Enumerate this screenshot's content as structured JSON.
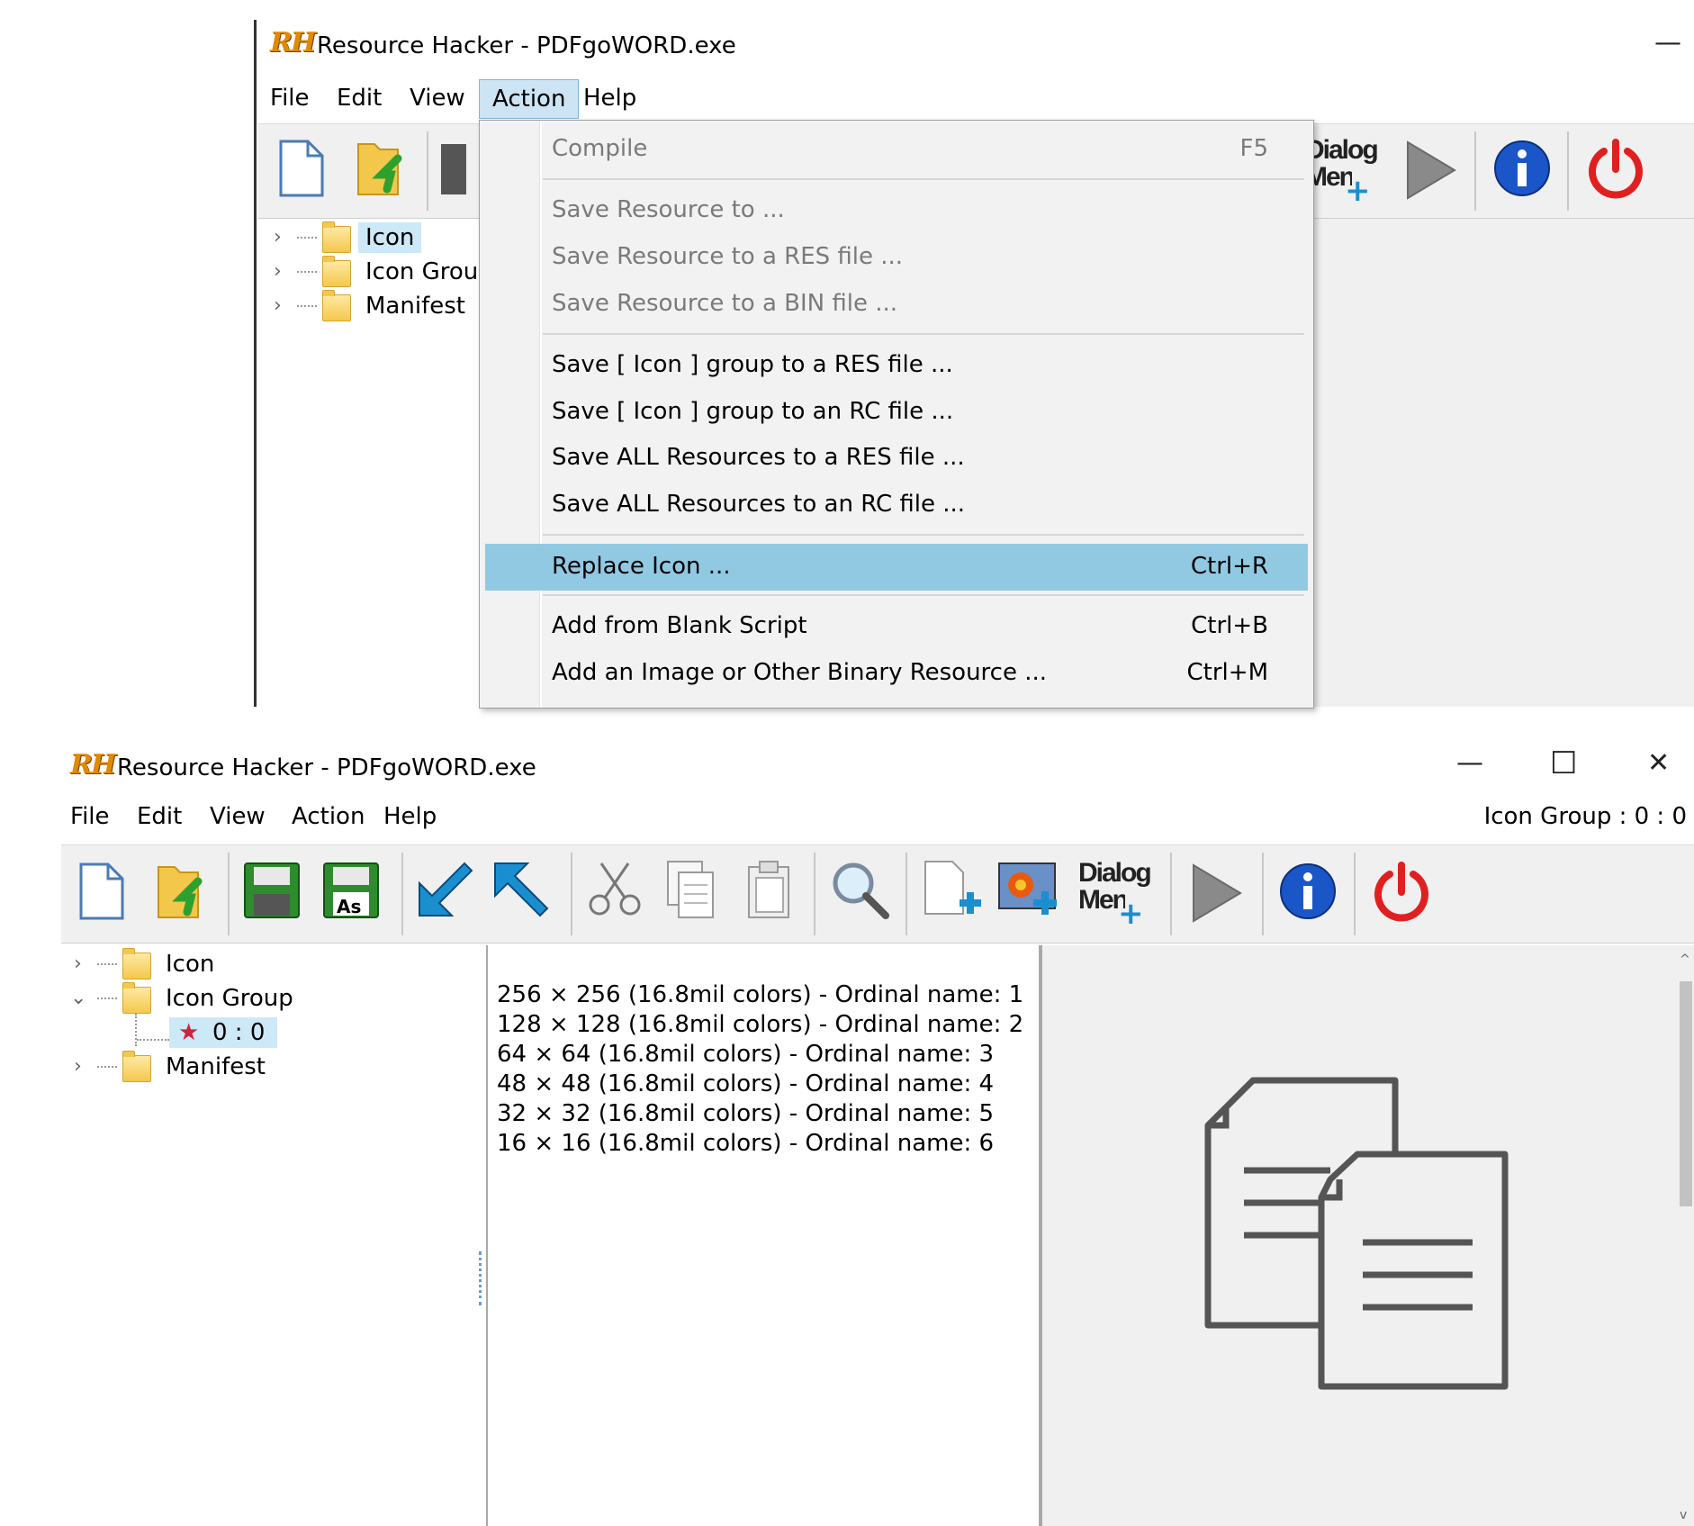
{
  "top": {
    "window": {
      "logo": "RH",
      "title": "Resource Hacker - PDFgoWORD.exe",
      "minimize_glyph": "—"
    },
    "menubar": [
      "File",
      "Edit",
      "View",
      "Action",
      "Help"
    ],
    "active_menu": "Action",
    "toolbar": {
      "dialog_menu_line1": "Dialog",
      "dialog_menu_line2": "Menu"
    },
    "tree": [
      {
        "label": "Icon",
        "selected": true
      },
      {
        "label": "Icon Grou"
      },
      {
        "label": "Manifest"
      }
    ],
    "action_menu": [
      {
        "label": "Compile",
        "shortcut": "F5",
        "disabled": true
      },
      {
        "label": "Save Resource to ...",
        "disabled": true
      },
      {
        "label": "Save Resource to a RES file ...",
        "disabled": true
      },
      {
        "label": "Save Resource to a BIN file ...",
        "disabled": true
      },
      {
        "label": "Save [ Icon ] group to a RES file ..."
      },
      {
        "label": "Save [ Icon ] group to an RC file ..."
      },
      {
        "label": "Save ALL Resources to a RES file ..."
      },
      {
        "label": "Save ALL Resources to an RC file ..."
      },
      {
        "label": "Replace Icon ...",
        "shortcut": "Ctrl+R",
        "highlighted": true
      },
      {
        "label": "Add from Blank Script",
        "shortcut": "Ctrl+B"
      },
      {
        "label": "Add an Image or Other Binary Resource ...",
        "shortcut": "Ctrl+M"
      }
    ]
  },
  "bottom": {
    "window": {
      "logo": "RH",
      "title": "Resource Hacker - PDFgoWORD.exe",
      "minimize_glyph": "—",
      "maximize_glyph": "☐",
      "close_glyph": "✕"
    },
    "menubar": [
      "File",
      "Edit",
      "View",
      "Action",
      "Help"
    ],
    "status": "Icon Group : 0 : 0",
    "toolbar": {
      "save_as_text": "As",
      "dialog_menu_line1": "Dialog",
      "dialog_menu_line2": "Menu"
    },
    "tree": [
      {
        "label": "Icon"
      },
      {
        "label": "Icon Group",
        "expanded": true
      },
      {
        "label": "0 : 0",
        "selected": true
      },
      {
        "label": "Manifest"
      }
    ],
    "icon_list": [
      "256 × 256 (16.8mil colors) - Ordinal name: 1",
      "128 × 128 (16.8mil colors) - Ordinal name: 2",
      "64 × 64 (16.8mil colors) - Ordinal name: 3",
      "48 × 48 (16.8mil colors) - Ordinal name: 4",
      "32 × 32 (16.8mil colors) - Ordinal name: 5",
      "16 × 16 (16.8mil colors) - Ordinal name: 6"
    ],
    "preview_icon": "copy-documents-icon"
  },
  "colors": {
    "menu_highlight": "#91c9e3",
    "tree_selection": "#cde8f7",
    "save_green": "#2e8b2e",
    "arrow_blue": "#1a8fd0",
    "power_red": "#e02020",
    "info_blue": "#1a56c8"
  }
}
